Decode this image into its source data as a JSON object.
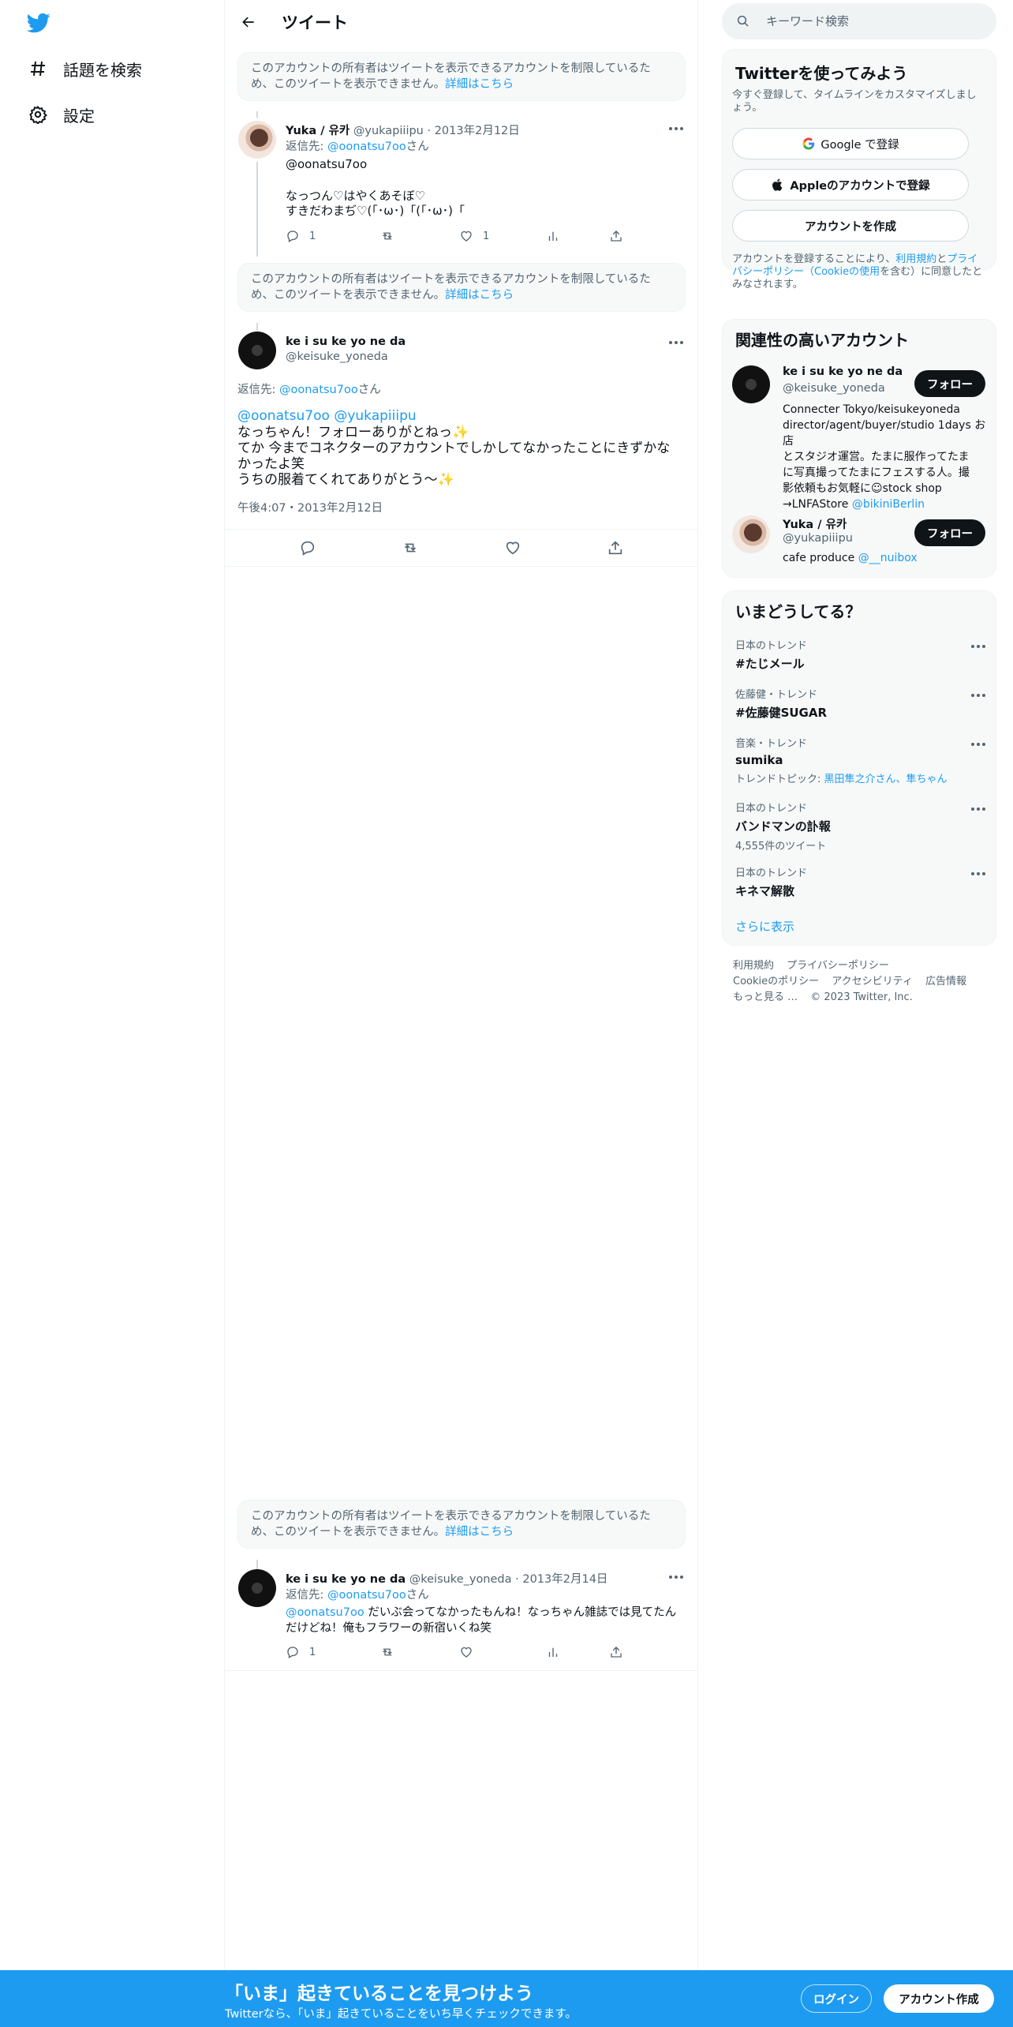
{
  "nav": {
    "explore_label": "話題を検索",
    "settings_label": "設定"
  },
  "header": {
    "title": "ツイート"
  },
  "notice": {
    "text": "このアカウントの所有者はツイートを表示できるアカウントを制限しているため、このツイートを表示できません。",
    "link": "詳細はこちら"
  },
  "tweet1": {
    "name": "Yuka / 유카",
    "handle": "@yukapiiipu",
    "date": "2013年2月12日",
    "reply_prefix": "返信先: ",
    "reply_to": "@oonatsu7oo",
    "reply_suffix": "さん",
    "mention": "@oonatsu7oo",
    "line1": "なっつん♡はやくあそぼ♡",
    "line2": "すきだわまぢ♡(「･ω･)「(「･ω･)「",
    "replies": "1",
    "likes": "1"
  },
  "main_tweet": {
    "name": "ke i su ke yo ne da",
    "handle": "@keisuke_yoneda",
    "reply_prefix": "返信先: ",
    "reply_to": "@oonatsu7oo",
    "reply_suffix": "さん",
    "mention1": "@oonatsu7oo",
    "mention2": "@yukapiiipu",
    "line1": "なっちゃん！フォローありがとねっ✨",
    "line2": "てか 今までコネクターのアカウントでしかしてなかったことにきずかな",
    "line3": "かったよ笑",
    "line4": "うちの服着てくれてありがとう〜✨",
    "timestamp": "午後4:07・2013年2月12日"
  },
  "tweet3": {
    "name": "ke i su ke yo ne da",
    "handle": "@keisuke_yoneda",
    "date": "2013年2月14日",
    "reply_prefix": "返信先: ",
    "reply_to": "@oonatsu7oo",
    "reply_suffix": "さん",
    "mention": "@oonatsu7oo",
    "line1": " だいぶ会ってなかったもんね！なっちゃん雑誌では見てたん",
    "line2": "だけどね！俺もフラワーの新宿いくね笑",
    "replies": "1"
  },
  "search": {
    "placeholder": "キーワード検索"
  },
  "signup_card": {
    "title": "Twitterを使ってみよう",
    "subtitle": "今すぐ登録して、タイムラインをカスタマイズしましょう。",
    "google": "Google で登録",
    "apple": "Appleのアカウントで登録",
    "create": "アカウントを作成",
    "terms_1": "アカウントを登録することにより、",
    "terms_link1": "利用規約",
    "terms_2": "と",
    "terms_link2": "プライバシーポリシー（Cookieの使用",
    "terms_3": "を含む）に同意したとみなされます。"
  },
  "related": {
    "title": "関連性の高いアカウント",
    "follow_label": "フォロー",
    "accounts": [
      {
        "name": "ke i su ke yo ne da",
        "handle": "@keisuke_yoneda",
        "bio1": "Connecter Tokyo/keisukeyoneda",
        "bio2": "director/agent/buyer/studio 1days お店",
        "bio3": "とスタジオ運営。たまに服作ってたま",
        "bio4": "に写真撮ってたまにフェスする人。撮",
        "bio5": "影依頼もお気軽に☺stock shop",
        "bio6": "→LNFAStore ",
        "bio_link": "@bikiniBerlin"
      },
      {
        "name": "Yuka / 유카",
        "handle": "@yukapiiipu",
        "bio1": "cafe produce ",
        "bio_link": "@__nuibox"
      }
    ]
  },
  "trends": {
    "title": "いまどうしてる？",
    "items": [
      {
        "category": "日本のトレンド",
        "title": "#たじメール",
        "extra": ""
      },
      {
        "category": "佐藤健・トレンド",
        "title": "#佐藤健SUGAR",
        "extra": ""
      },
      {
        "category": "音楽・トレンド",
        "title": "sumika",
        "extra_prefix": "トレンドトピック: ",
        "extra_link": "黒田隼之介さん、隼ちゃん"
      },
      {
        "category": "日本のトレンド",
        "title": "バンドマンの訃報",
        "extra": "4,555件のツイート"
      },
      {
        "category": "日本のトレンド",
        "title": "キネマ解散",
        "extra": ""
      }
    ],
    "show_more": "さらに表示"
  },
  "footer": {
    "terms": "利用規約",
    "privacy": "プライバシーポリシー",
    "cookie": "Cookieのポリシー",
    "accessibility": "アクセシビリティ",
    "ads": "広告情報",
    "more": "もっと見る …",
    "copyright": "© 2023 Twitter, Inc."
  },
  "bottom_bar": {
    "headline": "「いま」起きていることを見つけよう",
    "sub": "Twitterなら、「いま」起きていることをいち早くチェックできます。",
    "login": "ログイン",
    "signup": "アカウント作成"
  },
  "colors": {
    "accent": "#1d9bf0",
    "text": "#0f1419",
    "muted": "#536471",
    "border": "#eff3f4"
  }
}
